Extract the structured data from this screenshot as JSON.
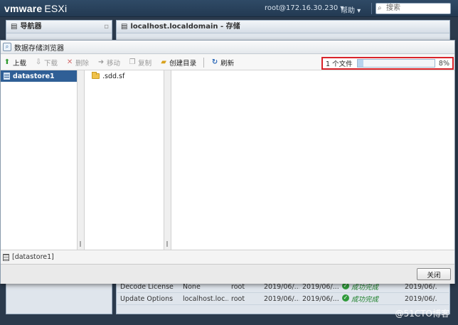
{
  "header": {
    "logo_vm": "vmware",
    "logo_product": "ESXi",
    "user": "root@172.16.30.230 ▾",
    "help": "帮助 ▾",
    "search_placeholder": "搜索"
  },
  "nav_panel": {
    "title": "导航器"
  },
  "main_panel": {
    "title": "localhost.localdomain - 存储"
  },
  "background_table": {
    "rows": [
      {
        "task": "Decode License",
        "target": "None",
        "initiator": "root",
        "queued": "2019/06/...",
        "started": "2019/06/...",
        "result": "成功完成",
        "completed": "2019/06/..."
      },
      {
        "task": "Update Options",
        "target": "localhost.loc...",
        "initiator": "root",
        "queued": "2019/06/...",
        "started": "2019/06/...",
        "result": "成功完成",
        "completed": "2019/06/..."
      }
    ]
  },
  "dialog": {
    "title": "数据存储浏览器",
    "toolbar": {
      "upload": "上载",
      "download": "下载",
      "delete": "删除",
      "move": "移动",
      "copy": "复制",
      "mkdir": "创建目录",
      "refresh": "刷新"
    },
    "progress": {
      "label": "1 个文件",
      "percent_text": "8%",
      "fraction": 0.08
    },
    "datastores": [
      {
        "name": "datastore1"
      }
    ],
    "folders": [
      {
        "name": ".sdd.sf"
      }
    ],
    "status_path": "[datastore1]",
    "close_label": "关闭"
  },
  "watermark": "@51CTO博客",
  "colors": {
    "selection": "#2f5f96",
    "progress_border": "#d9232a",
    "topbar": "#2f4a66"
  }
}
